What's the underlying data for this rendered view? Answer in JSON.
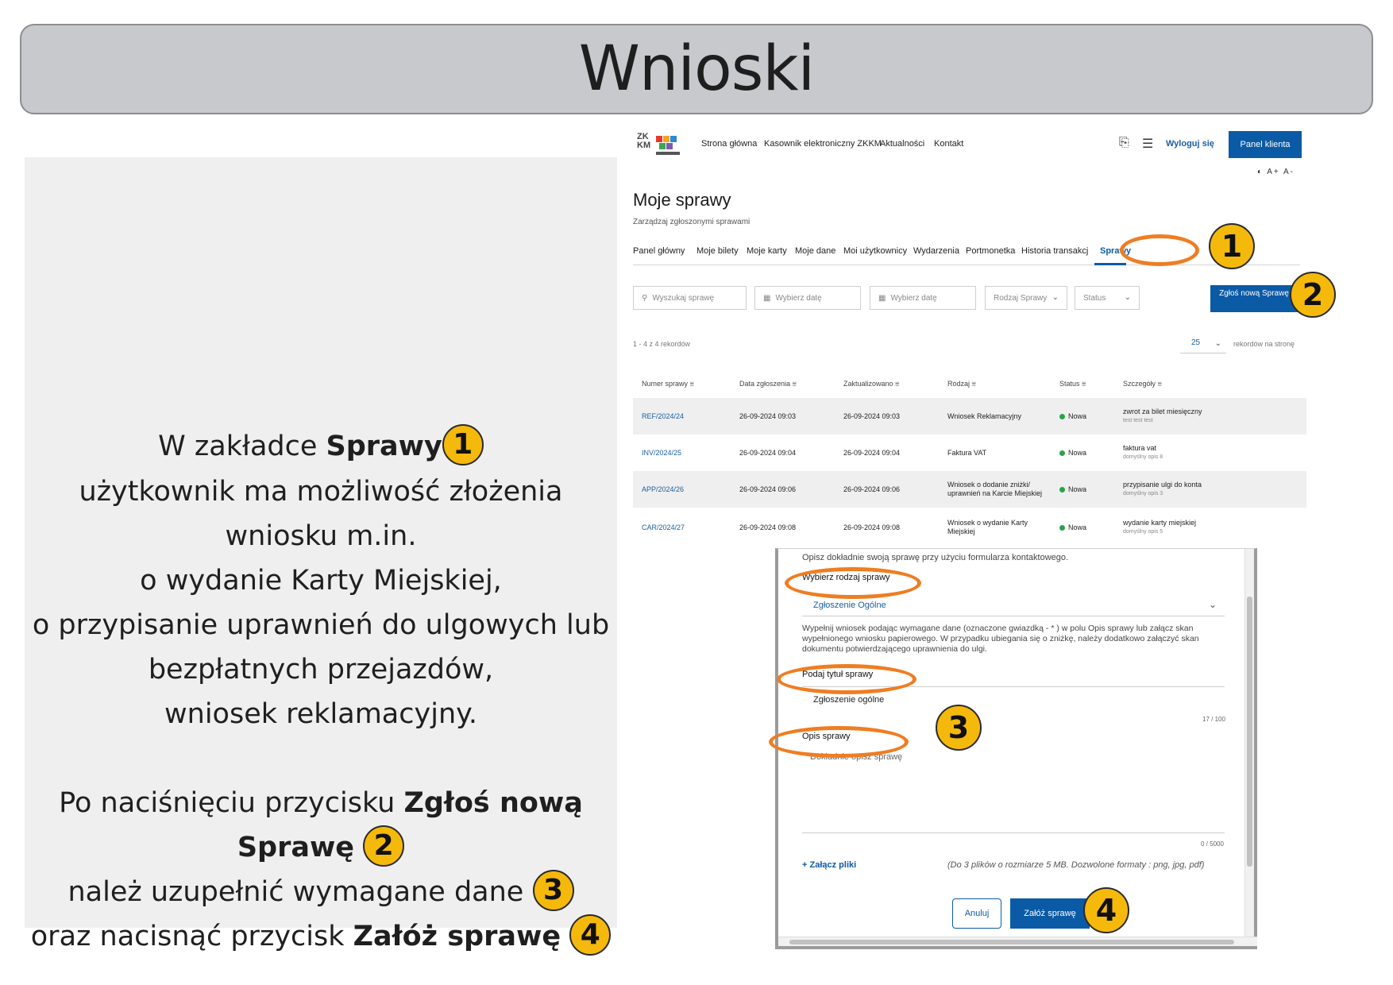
{
  "slide": {
    "title": "Wnioski"
  },
  "left": {
    "l1_pre": "W zakładce ",
    "l1_bold": "Sprawy",
    "l2": "użytkownik ma możliwość złożenia",
    "l3": "wniosku m.in.",
    "l4": "o wydanie Karty Miejskiej,",
    "l5": "o przypisanie uprawnień do ulgowych lub",
    "l6": "bezpłatnych przejazdów,",
    "l7": "wniosek reklamacyjny.",
    "l8_pre": "Po naciśnięciu przycisku ",
    "l8_bold": "Zgłoś nową",
    "l9_bold": "Sprawę",
    "l10": "należ uzupełnić wymagane dane",
    "l11_pre": "oraz nacisnąć przycisk ",
    "l11_bold": "Załóż sprawę"
  },
  "badges": [
    "1",
    "2",
    "3",
    "4"
  ],
  "app": {
    "logo_text": "ZK KM",
    "nav": [
      "Strona główna",
      "Kasownik elektroniczny ZKKM",
      "Aktualności",
      "Kontakt"
    ],
    "logout": "Wyloguj się",
    "panel_button": "Panel klienta",
    "a11y": "◐ A+ A-",
    "page_title": "Moje sprawy",
    "page_subtitle": "Zarządzaj zgłoszonymi sprawami",
    "tabs": [
      "Panel główny",
      "Moje bilety",
      "Moje karty",
      "Moje dane",
      "Moi użytkownicy",
      "Wydarzenia",
      "Portmonetka",
      "Historia transakcji",
      "Sprawy"
    ],
    "filters": {
      "search": "Wyszukaj sprawę",
      "date_from": "Wybierz datę",
      "date_to": "Wybierz datę",
      "type": "Rodzaj Sprawy",
      "status": "Status"
    },
    "add_button": "Zgłoś nową Sprawę",
    "records_info": "1 - 4 z 4 rekordów",
    "page_size": "25",
    "page_size_label": "rekordów na stronę",
    "columns": [
      "Numer sprawy",
      "Data zgłoszenia",
      "Zaktualizowano",
      "Rodzaj",
      "Status",
      "Szczegóły"
    ],
    "rows": [
      {
        "id": "REF/2024/24",
        "created": "26-09-2024 09:03",
        "updated": "26-09-2024 09:03",
        "type": "Wniosek Reklamacyjny",
        "status": "Nowa",
        "detail": "zwrot za bilet miesięczny",
        "detail_sub": "test test test"
      },
      {
        "id": "INV/2024/25",
        "created": "26-09-2024 09:04",
        "updated": "26-09-2024 09:04",
        "type": "Faktura VAT",
        "status": "Nowa",
        "detail": "faktura vat",
        "detail_sub": "domyślny opis 8"
      },
      {
        "id": "APP/2024/26",
        "created": "26-09-2024 09:06",
        "updated": "26-09-2024 09:06",
        "type": "Wniosek o dodanie zniżki/ uprawnień na Karcie Miejskiej",
        "status": "Nowa",
        "detail": "przypisanie ulgi do konta",
        "detail_sub": "domyślny opis 3"
      },
      {
        "id": "CAR/2024/27",
        "created": "26-09-2024 09:08",
        "updated": "26-09-2024 09:08",
        "type": "Wniosek o wydanie Karty Miejskiej",
        "status": "Nowa",
        "detail": "wydanie karty miejskiej",
        "detail_sub": "domyślny opis 5"
      }
    ]
  },
  "modal": {
    "intro": "Opisz dokładnie swoją sprawę przy użyciu formularza kontaktowego.",
    "type_label": "Wybierz rodzaj sprawy",
    "type_value": "Zgłoszenie Ogólne",
    "info": "Wypełnij wniosek podając wymagane dane (oznaczone gwiazdką - * ) w polu Opis sprawy lub załącz skan wypełnionego wniosku papierowego. W przypadku ubiegania się o zniżkę, należy dodatkowo załączyć skan dokumentu potwierdzającego uprawnienia do ulgi.",
    "title_label": "Podaj tytuł sprawy",
    "title_value": "Zgłoszenie ogólne",
    "title_count": "17 / 100",
    "desc_label": "Opis sprawy",
    "desc_placeholder": "Dokładnie opisz sprawę",
    "desc_count": "0 / 5000",
    "attach": "+ Załącz pliki",
    "attach_hint": "(Do 3 plików o rozmiarze 5 MB. Dozwolone formaty : png, jpg, pdf)",
    "cancel": "Anuluj",
    "submit": "Załóż sprawę"
  },
  "colors": {
    "accent": "#0b5aa6",
    "highlight_ring": "#ef7d22",
    "badge": "#f5b90b",
    "banner": "#c8c9cc",
    "status_green": "#2aa24a"
  }
}
